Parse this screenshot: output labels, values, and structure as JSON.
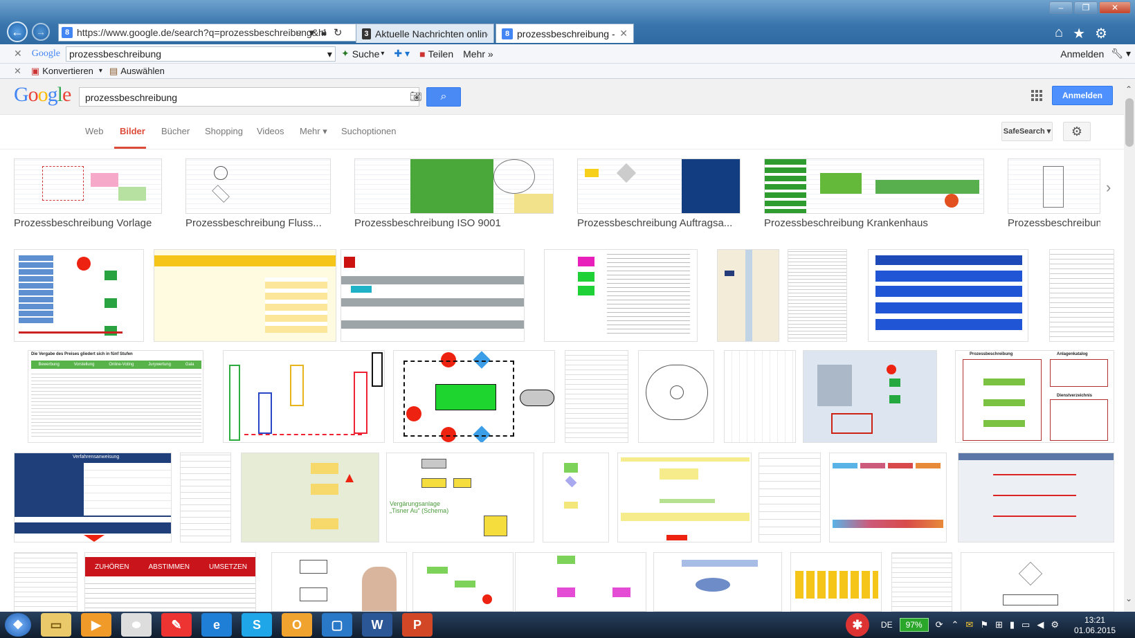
{
  "browser": {
    "back_icon": "back-arrow-icon",
    "forward_icon": "forward-arrow-icon",
    "address": "https://www.google.de/search?q=prozessbeschreibung&hl",
    "tabs": [
      {
        "title": "Aktuelle Nachrichten online - F...",
        "active": false
      },
      {
        "title": "prozessbeschreibung - Goo...",
        "active": true
      }
    ],
    "close_tab": "✕",
    "right_icons": [
      "home-icon",
      "star-icon",
      "gear-icon"
    ]
  },
  "google_toolbar": {
    "logo": "Google",
    "query": "prozessbeschreibung",
    "search_label": "Suche",
    "share_label": "Teilen",
    "more_label": "Mehr »",
    "signin_label": "Anmelden"
  },
  "pdf_toolbar": {
    "convert_label": "Konvertieren",
    "select_label": "Auswählen"
  },
  "google": {
    "logo": {
      "G": "G",
      "o1": "o",
      "o2": "o",
      "g": "g",
      "l": "l",
      "e": "e"
    },
    "query": "prozessbeschreibung",
    "signin": "Anmelden",
    "tabs": [
      "Web",
      "Bilder",
      "Bücher",
      "Shopping",
      "Videos",
      "Mehr ▾",
      "Suchoptionen"
    ],
    "active_tab": "Bilder",
    "safesearch": "SafeSearch ▾",
    "brand_blue": "#4285f4",
    "brand_red": "#ea4335",
    "brand_yellow": "#fbbc05",
    "brand_green": "#34a853"
  },
  "related_searches": [
    "Prozessbeschreibung Vorlage",
    "Prozessbeschreibung Fluss...",
    "Prozessbeschreibung ISO 9001",
    "Prozessbeschreibung Auftragsa...",
    "Prozessbeschreibung Krankenhaus",
    "Prozessbeschreibung QI"
  ],
  "image_texts": {
    "verfahrensanweisung": "Verfahrensanweisung",
    "vergaerung": "Vergärungsanlage „Tisner Au“ (Schema)",
    "zuhoeren": "ZUHÖREN",
    "abstimmen": "ABSTIMMEN",
    "umsetzen": "UMSETZEN",
    "prozessbeschreibung": "Prozessbeschreibung",
    "anlagenkatalog": "Anlagenkatalog",
    "dienstverzeichnis": "Dienstverzeichnis",
    "vergabe": "Die Vergabe des Preises gliedert sich in fünf Stufen",
    "stufen": [
      "Bewerbung",
      "Vorstellung",
      "Online-Voting",
      "Jurywertung",
      "Gala"
    ]
  },
  "taskbar": {
    "language": "DE",
    "battery": "97%",
    "time": "13:21",
    "date": "01.06.2015"
  }
}
